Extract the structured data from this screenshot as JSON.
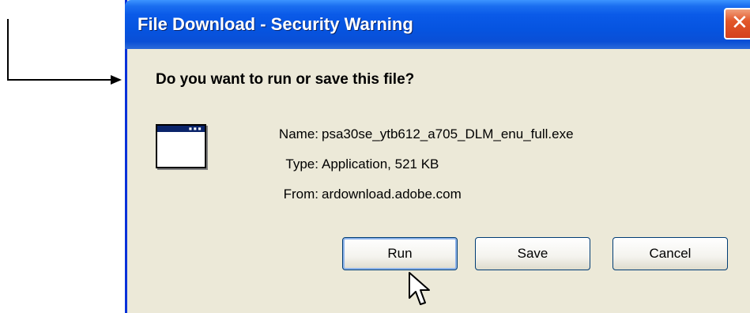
{
  "dialog": {
    "title": "File Download - Security Warning",
    "close_glyph": "✕",
    "question": "Do you want to run or save this file?",
    "icon": "application-window-icon",
    "fields": {
      "name_label": "Name:",
      "name_value": "psa30se_ytb612_a705_DLM_enu_full.exe",
      "type_label": "Type:",
      "type_value": "Application, 521 KB",
      "from_label": "From:",
      "from_value": "ardownload.adobe.com"
    },
    "buttons": {
      "run": "Run",
      "save": "Save",
      "cancel": "Cancel"
    }
  },
  "colors": {
    "titlebar": "#0a5ae8",
    "dialog_bg": "#ece9d8",
    "close_button": "#d4401c",
    "button_border": "#003c74"
  }
}
